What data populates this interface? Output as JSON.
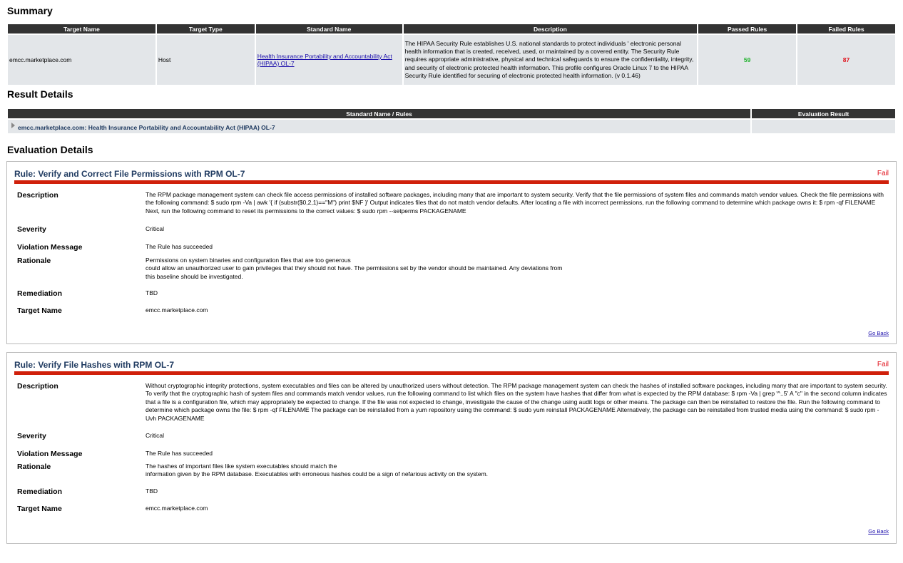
{
  "summary": {
    "heading": "Summary",
    "columns": [
      "Target Name",
      "Target Type",
      "Standard Name",
      "Description",
      "Passed Rules",
      "Failed Rules"
    ],
    "row": {
      "target_name": "emcc.marketplace.com",
      "target_type": "Host",
      "standard_name": "Health Insurance Portability and Accountability Act (HIPAA) OL-7",
      "description": "The HIPAA Security Rule establishes U.S. national standards to protect individuals ' electronic personal health information that is created, received, used, or maintained by a covered entity. The Security Rule requires appropriate administrative, physical and technical safeguards to ensure the confidentiality, integrity, and security of electronic protected health information. This profile configures Oracle Linux 7 to the HIPAA Security Rule identified for securing of electronic protected health information. (v 0.1.46)",
      "passed_rules": "59",
      "failed_rules": "87"
    }
  },
  "result_details": {
    "heading": "Result Details",
    "columns": [
      "Standard Name / Rules",
      "Evaluation Result"
    ],
    "row": {
      "name": "emcc.marketplace.com: Health Insurance Portability and Accountability Act (HIPAA) OL-7",
      "result": ""
    }
  },
  "evaluation": {
    "heading": "Evaluation Details",
    "labels": {
      "description": "Description",
      "severity": "Severity",
      "violation": "Violation Message",
      "rationale": "Rationale",
      "remediation": "Remediation",
      "target": "Target Name"
    },
    "go_back": "Go Back",
    "rules": [
      {
        "title": "Rule: Verify and Correct File Permissions with RPM OL-7",
        "status": "Fail",
        "description": "The RPM package management system can check file access permissions of installed software packages, including many that are important to system security. Verify that the file permissions of system files and commands match vendor values. Check the file permissions with the following command: $ sudo rpm -Va | awk '{ if (substr($0,2,1)==\"M\") print $NF }' Output indicates files that do not match vendor defaults. After locating a file with incorrect permissions, run the following command to determine which package owns it: $ rpm -qf FILENAME Next, run the following command to reset its permissions to the correct values: $ sudo rpm --setperms PACKAGENAME",
        "severity": "Critical",
        "violation": "The Rule has succeeded",
        "rationale_lines": [
          "Permissions on system binaries and configuration files that are too generous",
          "could allow an unauthorized user to gain privileges that they should not have. The permissions set by the vendor should be maintained. Any deviations from",
          "this baseline should be investigated."
        ],
        "remediation": "TBD",
        "target": "emcc.marketplace.com"
      },
      {
        "title": "Rule: Verify File Hashes with RPM OL-7",
        "status": "Fail",
        "description": "Without cryptographic integrity protections, system executables and files can be altered by unauthorized users without detection. The RPM package management system can check the hashes of installed software packages, including many that are important to system security. To verify that the cryptographic hash of system files and commands match vendor values, run the following command to list which files on the system have hashes that differ from what is expected by the RPM database: $ rpm -Va | grep '^..5' A \"c\" in the second column indicates that a file is a configuration file, which may appropriately be expected to change. If the file was not expected to change, investigate the cause of the change using audit logs or other means. The package can then be reinstalled to restore the file. Run the following command to determine which package owns the file: $ rpm -qf FILENAME The package can be reinstalled from a yum repository using the command: $ sudo yum reinstall PACKAGENAME Alternatively, the package can be reinstalled from trusted media using the command: $ sudo rpm -Uvh PACKAGENAME",
        "severity": "Critical",
        "violation": "The Rule has succeeded",
        "rationale_lines": [
          "The hashes of important files like system executables should match the",
          "information given by the RPM database. Executables with erroneous hashes could be a sign of nefarious activity on the system."
        ],
        "remediation": "TBD",
        "target": "emcc.marketplace.com"
      }
    ]
  },
  "colors": {
    "header_bg": "#333333",
    "cell_bg": "#e3e6e9",
    "pass": "#1fb22c",
    "fail": "#e0101a",
    "rule_title": "#1f3a60",
    "rule_bar": "#d0200b"
  }
}
